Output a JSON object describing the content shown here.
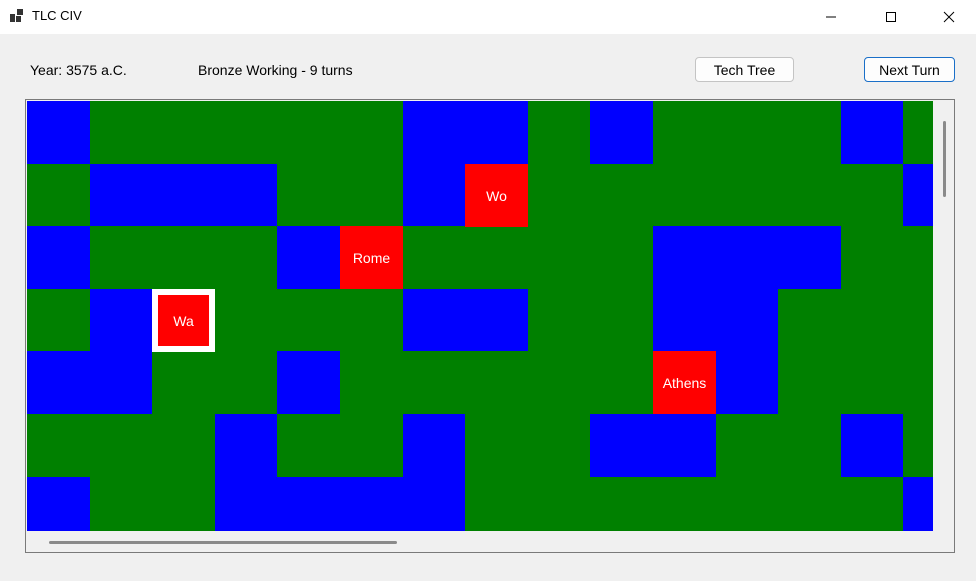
{
  "window": {
    "title": "TLC CIV",
    "app_icon": "app-window-icon"
  },
  "header": {
    "year": "Year: 3575 a.C.",
    "research": "Bronze Working - 9 turns",
    "tech_tree_label": "Tech Tree",
    "next_turn_label": "Next Turn"
  },
  "colors": {
    "water": "#0000ff",
    "land": "#008000",
    "city": "#ff0000",
    "selection": "#ffffff"
  },
  "map": {
    "legend": {
      "W": "water",
      "L": "land"
    },
    "rows": [
      "WLLLLLWWLWLLLWL",
      "LWWWLLWWLLLLLLW",
      "WLLLWLLLLLWWWLL",
      "LWLLLLWWLLWWLLL",
      "WWLLWLLLLLLWLLL",
      "LLLWLLWLLWWLLWL",
      "WLLWWWWLLLLLLLW"
    ],
    "cities": [
      {
        "name": "Wo",
        "row": 1,
        "col": 7,
        "selected": false
      },
      {
        "name": "Rome",
        "row": 2,
        "col": 5,
        "selected": false
      },
      {
        "name": "Wa",
        "row": 3,
        "col": 2,
        "selected": true
      },
      {
        "name": "Athens",
        "row": 4,
        "col": 10,
        "selected": false
      }
    ]
  }
}
